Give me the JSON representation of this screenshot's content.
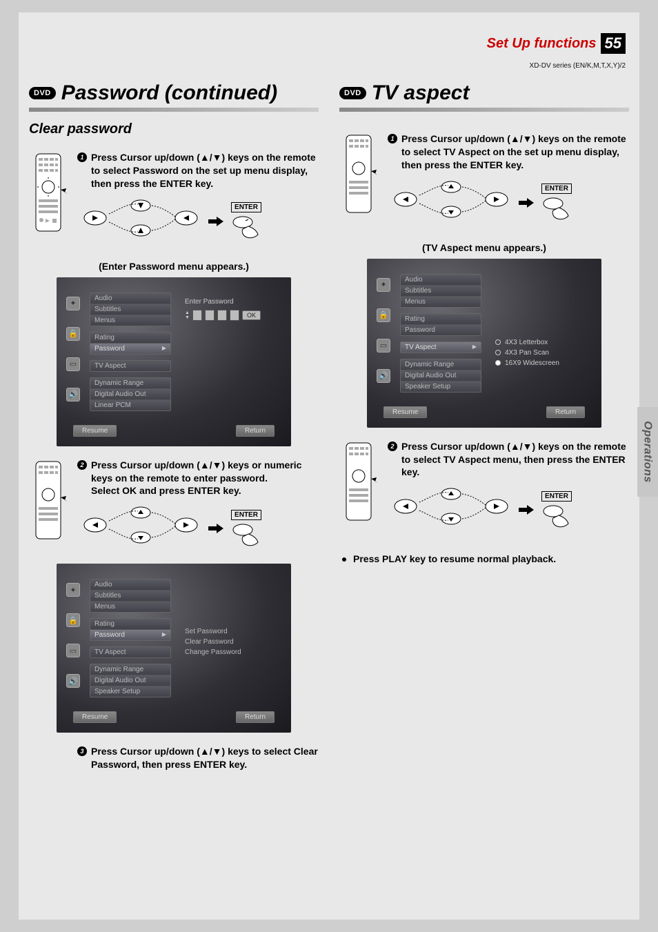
{
  "header": {
    "section": "Set Up functions",
    "page": "55",
    "model": "XD-DV series (EN/K,M,T,X,Y)/2"
  },
  "dvd_badge": "DVD",
  "left": {
    "title": "Password (continued)",
    "subtitle": "Clear password",
    "step1": "Press Cursor up/down (▲/▼) keys on the remote to select Password on the set up menu display, then press the ENTER key.",
    "enter": "ENTER",
    "caption1": "(Enter Password menu appears.)",
    "step2": "Press Cursor up/down (▲/▼) keys or numeric keys on the remote to enter password.\nSelect OK and press ENTER key.",
    "step3": "Press Cursor up/down (▲/▼) keys to select Clear Password, then press ENTER key."
  },
  "right": {
    "title": "TV aspect",
    "step1": "Press Cursor up/down (▲/▼) keys on the remote to select TV Aspect on the set up menu display, then press the ENTER key.",
    "enter": "ENTER",
    "caption1": "(TV Aspect menu appears.)",
    "step2": "Press Cursor up/down (▲/▼) keys on the remote to select TV Aspect menu, then press the ENTER key.",
    "bullet": "Press PLAY key to resume normal playback."
  },
  "menus": {
    "items_g1": [
      "Audio",
      "Subtitles",
      "Menus"
    ],
    "items_g2": [
      "Rating",
      "Password"
    ],
    "items_g3": [
      "TV Aspect"
    ],
    "items_g4": [
      "Dynamic Range",
      "Digital Audio Out",
      "Linear PCM"
    ],
    "items_g4b": [
      "Dynamic Range",
      "Digital Audio Out",
      "Speaker Setup"
    ],
    "resume": "Resume",
    "return": "Return",
    "enter_password": "Enter Password",
    "ok": "OK",
    "submenu_pw": [
      "Set Password",
      "Clear Password",
      "Change Password"
    ],
    "aspect_options": [
      "4X3 Letterbox",
      "4X3 Pan Scan",
      "16X9 Widescreen"
    ]
  },
  "sidetab": "Operations"
}
